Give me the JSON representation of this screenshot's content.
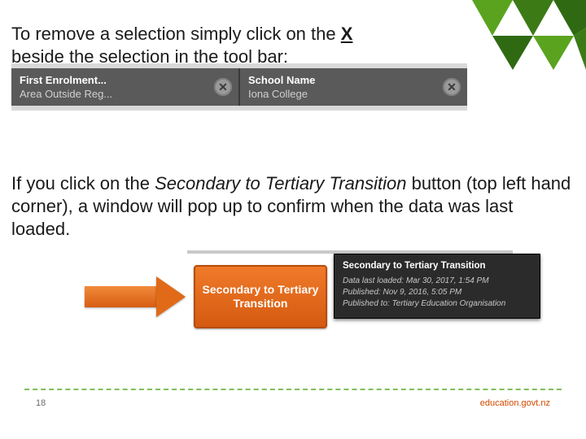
{
  "para1_a": "To remove a selection simply click on the ",
  "para1_x": "X",
  "para1_b": " beside the selection in the tool bar:",
  "toolbar": {
    "chips": [
      {
        "title": "First Enrolment...",
        "value": "Area Outside Reg...",
        "close_glyph": "✕"
      },
      {
        "title": "School Name",
        "value": "Iona College",
        "close_glyph": "✕"
      }
    ]
  },
  "para2_a": "If you click on the ",
  "para2_btn": "Secondary to Tertiary Transition",
  "para2_b": " button (top left hand corner), a window will pop up to confirm when the data was last loaded.",
  "orange_button_label": "Secondary to Tertiary Transition",
  "tooltip": {
    "title": "Secondary to Tertiary Transition",
    "lines": [
      "Data last loaded: Mar 30, 2017, 1:54 PM",
      "Published: Nov 9, 2016, 5:05 PM",
      "Published to: Tertiary Education Organisation"
    ]
  },
  "page_number": "18",
  "footer_url": "education.govt.nz"
}
